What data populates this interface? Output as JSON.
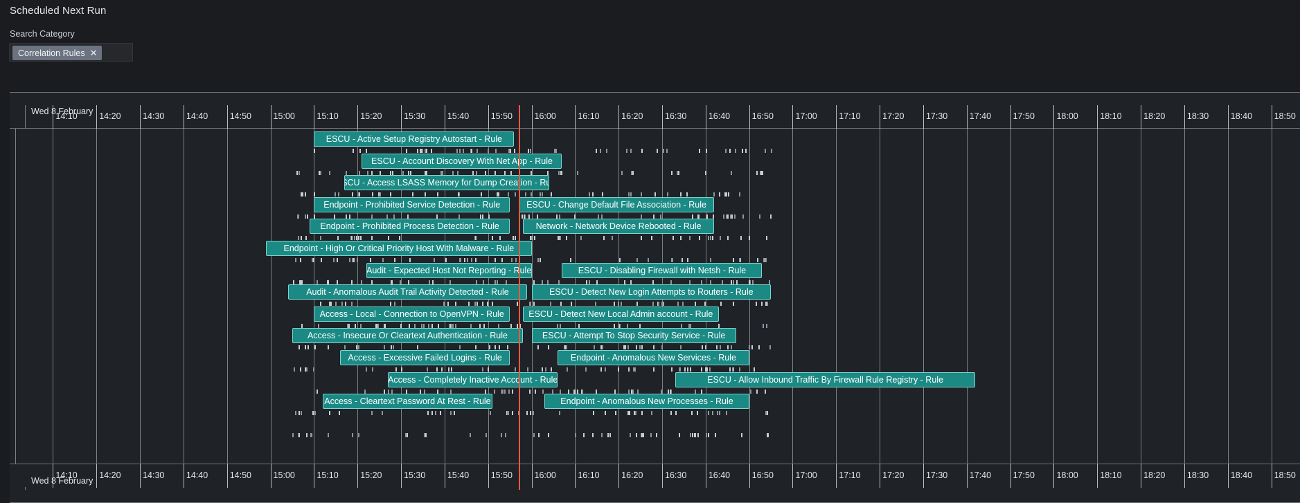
{
  "header": {
    "panel_title": "Scheduled Next Run",
    "field_label": "Search Category",
    "token_label": "Correlation Rules",
    "token_remove_icon": "close-x-icon"
  },
  "chart_data": {
    "type": "bar",
    "orientation": "horizontal-timeline",
    "title": "Scheduled Next Run",
    "xlabel": "Wed 8 February",
    "ylabel": "",
    "day_label": "Wed 8 February",
    "axis_min_time": "14:05",
    "axis_max_time": "18:55",
    "grid": true,
    "legend": "none",
    "now_marker_time": "15:57",
    "accent_color": "#1b8a84",
    "bar_border_color": "#7fd4cf",
    "now_marker_color": "#f0583f",
    "tick_labels": [
      "14:10",
      "14:20",
      "14:30",
      "14:40",
      "14:50",
      "15:00",
      "15:10",
      "15:20",
      "15:30",
      "15:40",
      "15:50",
      "16:00",
      "16:10",
      "16:20",
      "16:30",
      "16:40",
      "16:50",
      "17:00",
      "17:10",
      "17:20",
      "17:30",
      "17:40",
      "17:50",
      "18:00",
      "18:10",
      "18:20",
      "18:30",
      "18:40",
      "18:50"
    ],
    "categories": [
      "ESCU - Active Setup Registry Autostart - Rule",
      "ESCU - Account Discovery With Net App - Rule",
      "ESCU - Access LSASS Memory for Dump Creation - Rule",
      "Endpoint - Prohibited Service Detection - Rule",
      "ESCU - Change Default File Association - Rule",
      "Endpoint - Prohibited Process Detection - Rule",
      "Network - Network Device Rebooted - Rule",
      "Endpoint - High Or Critical Priority Host With Malware - Rule",
      "Audit - Expected Host Not Reporting - Rule",
      "ESCU - Disabling Firewall with Netsh - Rule",
      "Audit - Anomalous Audit Trail Activity Detected - Rule",
      "ESCU - Detect New Login Attempts to Routers - Rule",
      "Access - Local - Connection to OpenVPN - Rule",
      "ESCU - Detect New Local Admin account - Rule",
      "Access - Insecure Or Cleartext Authentication - Rule",
      "ESCU - Attempt To Stop Security Service - Rule",
      "Access - Excessive Failed Logins - Rule",
      "Endpoint - Anomalous New Services - Rule",
      "Access - Completely Inactive Account - Rule",
      "ESCU - Allow Inbound Traffic By Firewall Rule Registry - Rule",
      "Access - Cleartext Password At Rest - Rule",
      "Endpoint - Anomalous New Processes - Rule"
    ],
    "bars": [
      {
        "label": "ESCU - Active Setup Registry Autostart - Rule",
        "row": 0,
        "start": "15:10",
        "end": "15:56"
      },
      {
        "label": "ESCU - Account Discovery With Net App - Rule",
        "row": 1,
        "start": "15:21",
        "end": "16:07"
      },
      {
        "label": "ESCU - Access LSASS Memory for Dump Creation - Rule",
        "row": 2,
        "start": "15:17",
        "end": "16:04"
      },
      {
        "label": "Endpoint - Prohibited Service Detection - Rule",
        "row": 3,
        "start": "15:10",
        "end": "15:55"
      },
      {
        "label": "ESCU - Change Default File Association - Rule",
        "row": 3,
        "start": "15:57",
        "end": "16:42"
      },
      {
        "label": "Endpoint - Prohibited Process Detection - Rule",
        "row": 4,
        "start": "15:09",
        "end": "15:55"
      },
      {
        "label": "Network - Network Device Rebooted - Rule",
        "row": 4,
        "start": "15:58",
        "end": "16:42"
      },
      {
        "label": "Endpoint - High Or Critical Priority Host With Malware - Rule",
        "row": 5,
        "start": "14:59",
        "end": "16:00"
      },
      {
        "label": "Audit - Expected Host Not Reporting - Rule",
        "row": 6,
        "start": "15:22",
        "end": "16:00"
      },
      {
        "label": "ESCU - Disabling Firewall with Netsh - Rule",
        "row": 6,
        "start": "16:07",
        "end": "16:53"
      },
      {
        "label": "Audit - Anomalous Audit Trail Activity Detected - Rule",
        "row": 7,
        "start": "15:04",
        "end": "15:59"
      },
      {
        "label": "ESCU - Detect New Login Attempts to Routers - Rule",
        "row": 7,
        "start": "16:00",
        "end": "16:55"
      },
      {
        "label": "Access - Local - Connection to OpenVPN - Rule",
        "row": 8,
        "start": "15:10",
        "end": "15:55"
      },
      {
        "label": "ESCU - Detect New Local Admin account - Rule",
        "row": 8,
        "start": "15:58",
        "end": "16:43"
      },
      {
        "label": "Access - Insecure Or Cleartext Authentication - Rule",
        "row": 9,
        "start": "15:05",
        "end": "15:58"
      },
      {
        "label": "ESCU - Attempt To Stop Security Service - Rule",
        "row": 9,
        "start": "16:00",
        "end": "16:47"
      },
      {
        "label": "Access - Excessive Failed Logins - Rule",
        "row": 10,
        "start": "15:16",
        "end": "15:55"
      },
      {
        "label": "Endpoint - Anomalous New Services - Rule",
        "row": 10,
        "start": "16:06",
        "end": "16:50"
      },
      {
        "label": "Access - Completely Inactive Account - Rule",
        "row": 11,
        "start": "15:27",
        "end": "16:06"
      },
      {
        "label": "ESCU - Allow Inbound Traffic By Firewall Rule Registry - Rule",
        "row": 11,
        "start": "16:33",
        "end": "17:42"
      },
      {
        "label": "Access - Cleartext Password At Rest - Rule",
        "row": 12,
        "start": "15:12",
        "end": "15:51"
      },
      {
        "label": "Endpoint - Anomalous New Processes - Rule",
        "row": 12,
        "start": "16:03",
        "end": "16:50"
      }
    ]
  }
}
